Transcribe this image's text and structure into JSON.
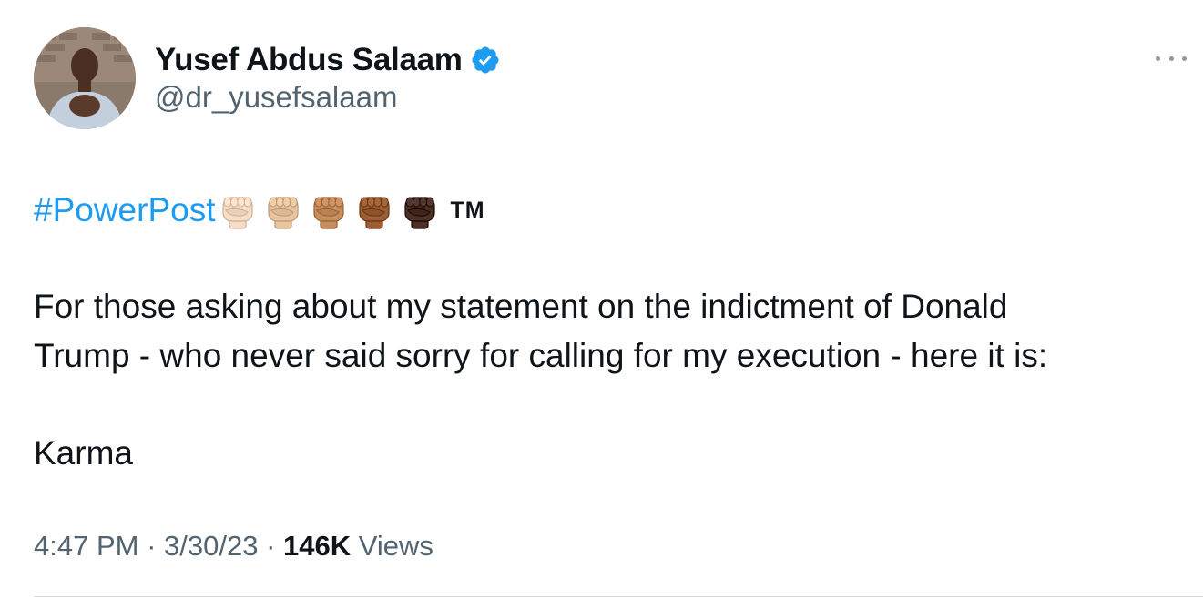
{
  "tweet": {
    "author": {
      "display_name": "Yusef Abdus Salaam",
      "handle": "@dr_yusefsalaam",
      "verified": true,
      "avatar_icon": "profile-photo",
      "badge_icon": "verified-badge-icon"
    },
    "hashtag": "#PowerPost",
    "fists": [
      {
        "icon": "raised-fist-light-icon",
        "color": "#f7dcc6"
      },
      {
        "icon": "raised-fist-medium-light-icon",
        "color": "#e8c4a0"
      },
      {
        "icon": "raised-fist-medium-icon",
        "color": "#c68d5e"
      },
      {
        "icon": "raised-fist-medium-dark-icon",
        "color": "#9a5f36"
      },
      {
        "icon": "raised-fist-dark-icon",
        "color": "#4a3128"
      }
    ],
    "trademark": "TM",
    "body": {
      "line1": "For those asking about my statement on the indictment of Donald",
      "line2": "Trump - who never said sorry for calling for my execution - here it is:",
      "line3": "Karma"
    },
    "meta": {
      "time": "4:47 PM",
      "date": "3/30/23",
      "views_count": "146K",
      "views_label": "Views",
      "separator": "·"
    }
  },
  "colors": {
    "link": "#1d9bf0",
    "text": "#0f1419",
    "secondary": "#536471",
    "divider": "#cfd9de"
  }
}
